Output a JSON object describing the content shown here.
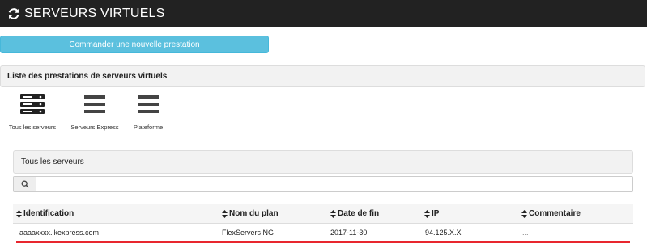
{
  "header": {
    "title": "SERVEURS VIRTUELS",
    "icon": "refresh-icon"
  },
  "order_button": {
    "label": "Commander une nouvelle prestation"
  },
  "list_panel": {
    "title": "Liste des prestations de serveurs virtuels"
  },
  "categories": [
    {
      "label": "Tous les serveurs",
      "icon": "server-stack-icon"
    },
    {
      "label": "Serveurs Express",
      "icon": "bars-icon"
    },
    {
      "label": "Plateforme",
      "icon": "bars-icon"
    }
  ],
  "subpanel": {
    "title": "Tous les serveurs"
  },
  "search": {
    "placeholder": "",
    "icon": "search-icon"
  },
  "table": {
    "columns": [
      "Identification",
      "Nom du plan",
      "Date de fin",
      "IP",
      "Commentaire"
    ],
    "rows": [
      {
        "identification": "aaaaxxxx.ikexpress.com",
        "plan": "FlexServers NG",
        "date_fin": "2017-11-30",
        "ip": "94.125.X.X",
        "commentaire": "..."
      }
    ]
  },
  "colors": {
    "topbar": "#222222",
    "accent_button": "#5bc0de",
    "highlight_line": "#e8262e"
  }
}
